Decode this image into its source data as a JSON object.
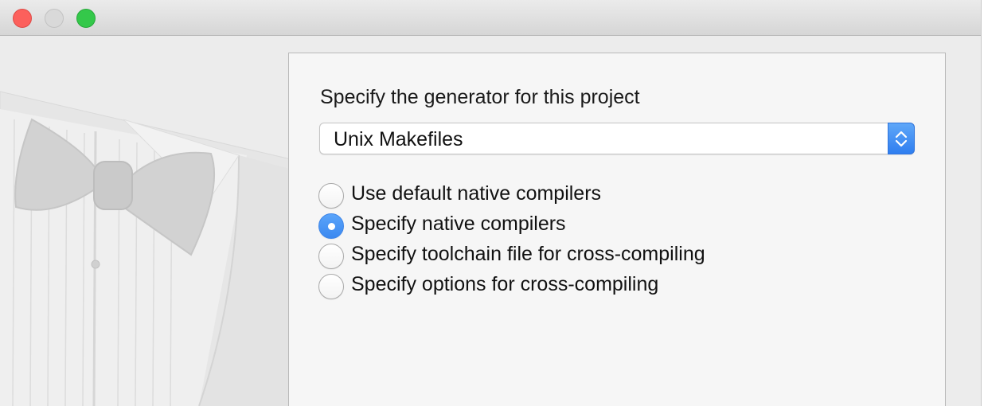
{
  "window": {
    "controls": {
      "close_color": "#fc605c",
      "minimize_color": "#d9d9d9",
      "zoom_color": "#34c84a"
    }
  },
  "art": {
    "icon": "cmake-tuxedo-bowtie-illustration"
  },
  "generator": {
    "heading": "Specify the generator for this project",
    "selected": "Unix Makefiles",
    "stepper_icon": "chevron-up-down-icon",
    "accent": "#3c89f0"
  },
  "compiler_options": [
    {
      "label": "Use default native compilers",
      "selected": false
    },
    {
      "label": "Specify native compilers",
      "selected": true
    },
    {
      "label": "Specify toolchain file for cross-compiling",
      "selected": false
    },
    {
      "label": "Specify options for cross-compiling",
      "selected": false
    }
  ]
}
